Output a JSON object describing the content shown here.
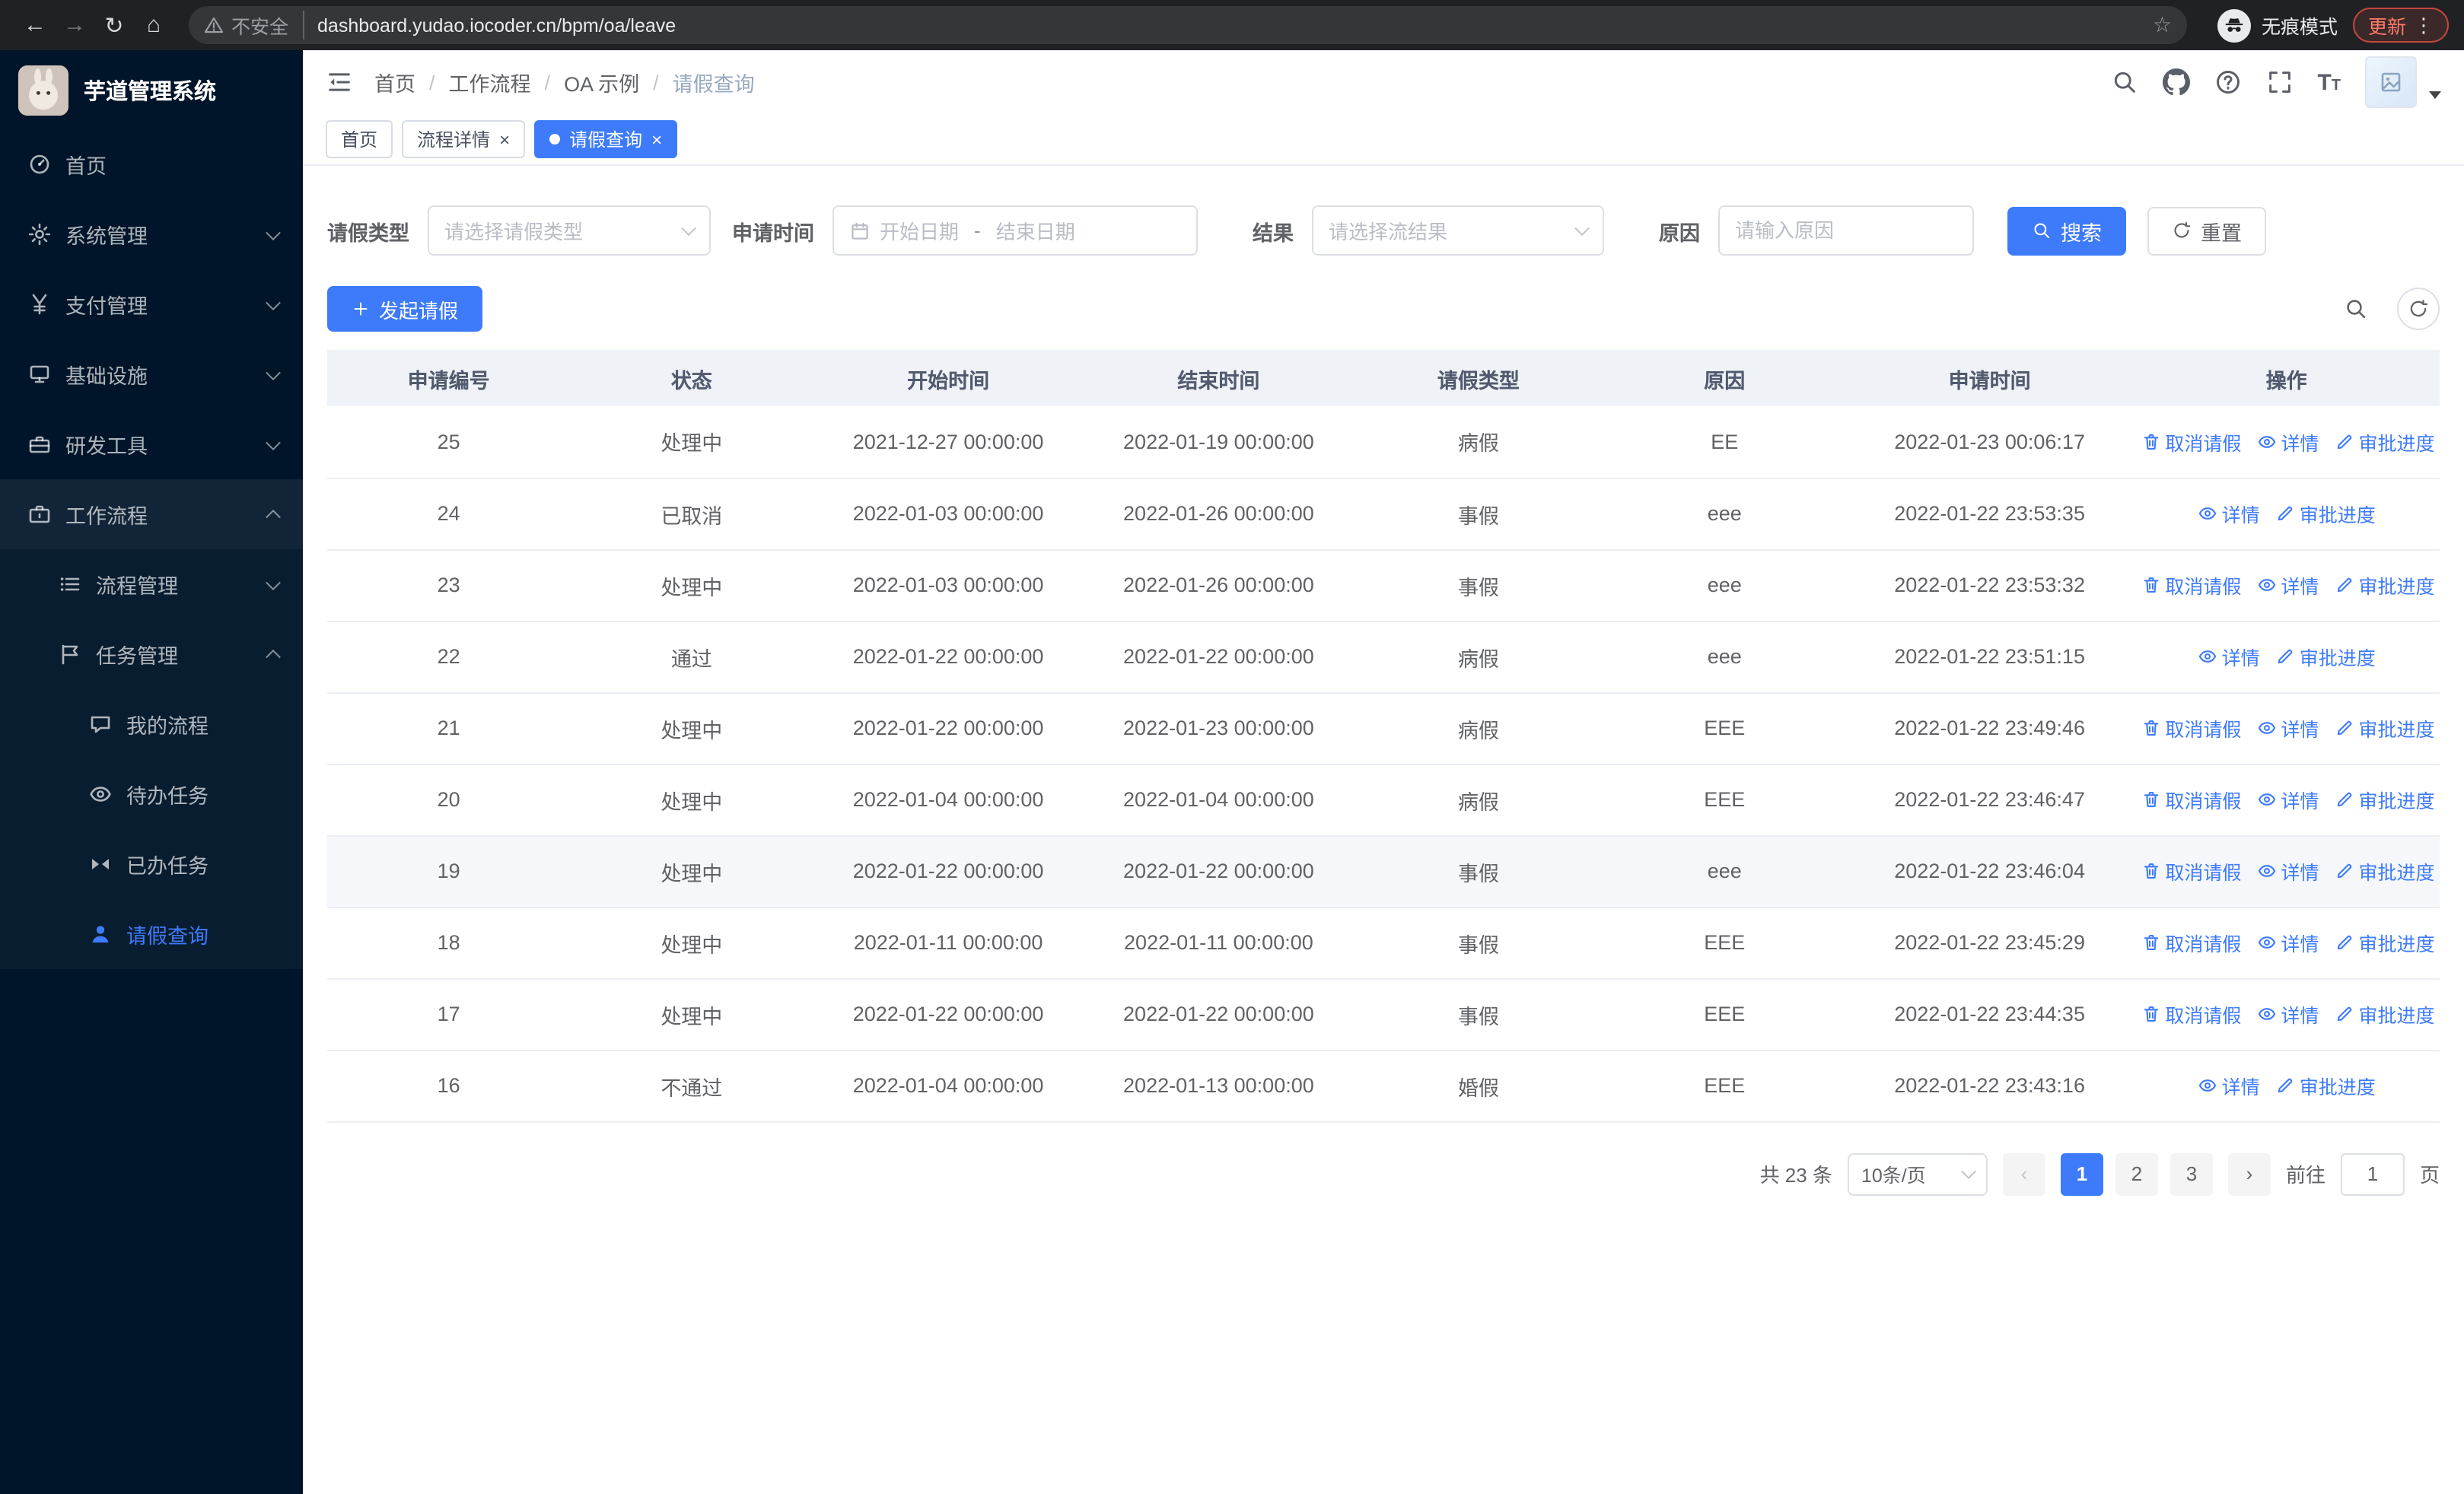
{
  "colors": {
    "primary": "#3e7bfa",
    "sidebar_bg": "#001529"
  },
  "browser": {
    "security_label": "不安全",
    "url": "dashboard.yudao.iocoder.cn/bpm/oa/leave",
    "incognito_label": "无痕模式",
    "update_label": "更新"
  },
  "sidebar": {
    "logo_title": "芋道管理系统",
    "items": [
      {
        "label": "首页",
        "icon": "dashboard-icon",
        "depth": 0,
        "expandable": false,
        "expanded": false,
        "active": false
      },
      {
        "label": "系统管理",
        "icon": "gear-icon",
        "depth": 0,
        "expandable": true,
        "expanded": false,
        "active": false
      },
      {
        "label": "支付管理",
        "icon": "yen-icon",
        "depth": 0,
        "expandable": true,
        "expanded": false,
        "active": false
      },
      {
        "label": "基础设施",
        "icon": "infrastructure-icon",
        "depth": 0,
        "expandable": true,
        "expanded": false,
        "active": false
      },
      {
        "label": "研发工具",
        "icon": "devtools-icon",
        "depth": 0,
        "expandable": true,
        "expanded": false,
        "active": false
      },
      {
        "label": "工作流程",
        "icon": "workflow-icon",
        "depth": 0,
        "expandable": true,
        "expanded": true,
        "active": false
      },
      {
        "label": "流程管理",
        "icon": "process-manage-icon",
        "depth": 1,
        "expandable": true,
        "expanded": false,
        "active": false
      },
      {
        "label": "任务管理",
        "icon": "task-manage-icon",
        "depth": 1,
        "expandable": true,
        "expanded": true,
        "active": false
      },
      {
        "label": "我的流程",
        "icon": "my-process-icon",
        "depth": 2,
        "expandable": false,
        "expanded": false,
        "active": false
      },
      {
        "label": "待办任务",
        "icon": "todo-task-icon",
        "depth": 2,
        "expandable": false,
        "expanded": false,
        "active": false
      },
      {
        "label": "已办任务",
        "icon": "done-task-icon",
        "depth": 2,
        "expandable": false,
        "expanded": false,
        "active": false
      },
      {
        "label": "请假查询",
        "icon": "leave-query-icon",
        "depth": 2,
        "expandable": false,
        "expanded": false,
        "active": true
      }
    ]
  },
  "header": {
    "breadcrumb": [
      "首页",
      "工作流程",
      "OA 示例",
      "请假查询"
    ],
    "separator": "/"
  },
  "tabs": [
    {
      "label": "首页",
      "closable": false,
      "active": false
    },
    {
      "label": "流程详情",
      "closable": true,
      "active": false
    },
    {
      "label": "请假查询",
      "closable": true,
      "active": true
    }
  ],
  "filters": {
    "leave_type_label": "请假类型",
    "leave_type_placeholder": "请选择请假类型",
    "apply_time_label": "申请时间",
    "start_placeholder": "开始日期",
    "range_separator": "-",
    "end_placeholder": "结束日期",
    "result_label": "结果",
    "result_placeholder": "请选择流结果",
    "reason_label": "原因",
    "reason_placeholder": "请输入原因",
    "search_label": "搜索",
    "reset_label": "重置"
  },
  "toolbar": {
    "create_label": "发起请假"
  },
  "table": {
    "columns": [
      "申请编号",
      "状态",
      "开始时间",
      "结束时间",
      "请假类型",
      "原因",
      "申请时间",
      "操作"
    ],
    "action_labels": {
      "cancel": "取消请假",
      "detail": "详情",
      "progress": "审批进度"
    },
    "rows": [
      {
        "id": "25",
        "status": "处理中",
        "start": "2021-12-27 00:00:00",
        "end": "2022-01-19 00:00:00",
        "type": "病假",
        "reason": "EE",
        "apply_time": "2022-01-23 00:06:17",
        "actions": [
          "cancel",
          "detail",
          "progress"
        ],
        "hover": false
      },
      {
        "id": "24",
        "status": "已取消",
        "start": "2022-01-03 00:00:00",
        "end": "2022-01-26 00:00:00",
        "type": "事假",
        "reason": "eee",
        "apply_time": "2022-01-22 23:53:35",
        "actions": [
          "detail",
          "progress"
        ],
        "hover": false
      },
      {
        "id": "23",
        "status": "处理中",
        "start": "2022-01-03 00:00:00",
        "end": "2022-01-26 00:00:00",
        "type": "事假",
        "reason": "eee",
        "apply_time": "2022-01-22 23:53:32",
        "actions": [
          "cancel",
          "detail",
          "progress"
        ],
        "hover": false
      },
      {
        "id": "22",
        "status": "通过",
        "start": "2022-01-22 00:00:00",
        "end": "2022-01-22 00:00:00",
        "type": "病假",
        "reason": "eee",
        "apply_time": "2022-01-22 23:51:15",
        "actions": [
          "detail",
          "progress"
        ],
        "hover": false
      },
      {
        "id": "21",
        "status": "处理中",
        "start": "2022-01-22 00:00:00",
        "end": "2022-01-23 00:00:00",
        "type": "病假",
        "reason": "EEE",
        "apply_time": "2022-01-22 23:49:46",
        "actions": [
          "cancel",
          "detail",
          "progress"
        ],
        "hover": false
      },
      {
        "id": "20",
        "status": "处理中",
        "start": "2022-01-04 00:00:00",
        "end": "2022-01-04 00:00:00",
        "type": "病假",
        "reason": "EEE",
        "apply_time": "2022-01-22 23:46:47",
        "actions": [
          "cancel",
          "detail",
          "progress"
        ],
        "hover": false
      },
      {
        "id": "19",
        "status": "处理中",
        "start": "2022-01-22 00:00:00",
        "end": "2022-01-22 00:00:00",
        "type": "事假",
        "reason": "eee",
        "apply_time": "2022-01-22 23:46:04",
        "actions": [
          "cancel",
          "detail",
          "progress"
        ],
        "hover": true
      },
      {
        "id": "18",
        "status": "处理中",
        "start": "2022-01-11 00:00:00",
        "end": "2022-01-11 00:00:00",
        "type": "事假",
        "reason": "EEE",
        "apply_time": "2022-01-22 23:45:29",
        "actions": [
          "cancel",
          "detail",
          "progress"
        ],
        "hover": false
      },
      {
        "id": "17",
        "status": "处理中",
        "start": "2022-01-22 00:00:00",
        "end": "2022-01-22 00:00:00",
        "type": "事假",
        "reason": "EEE",
        "apply_time": "2022-01-22 23:44:35",
        "actions": [
          "cancel",
          "detail",
          "progress"
        ],
        "hover": false
      },
      {
        "id": "16",
        "status": "不通过",
        "start": "2022-01-04 00:00:00",
        "end": "2022-01-13 00:00:00",
        "type": "婚假",
        "reason": "EEE",
        "apply_time": "2022-01-22 23:43:16",
        "actions": [
          "detail",
          "progress"
        ],
        "hover": false
      }
    ]
  },
  "pagination": {
    "total_text": "共 23 条",
    "page_size_label": "10条/页",
    "pages": [
      "1",
      "2",
      "3"
    ],
    "active_page": "1",
    "goto_label": "前往",
    "goto_value": "1",
    "goto_suffix": "页"
  }
}
